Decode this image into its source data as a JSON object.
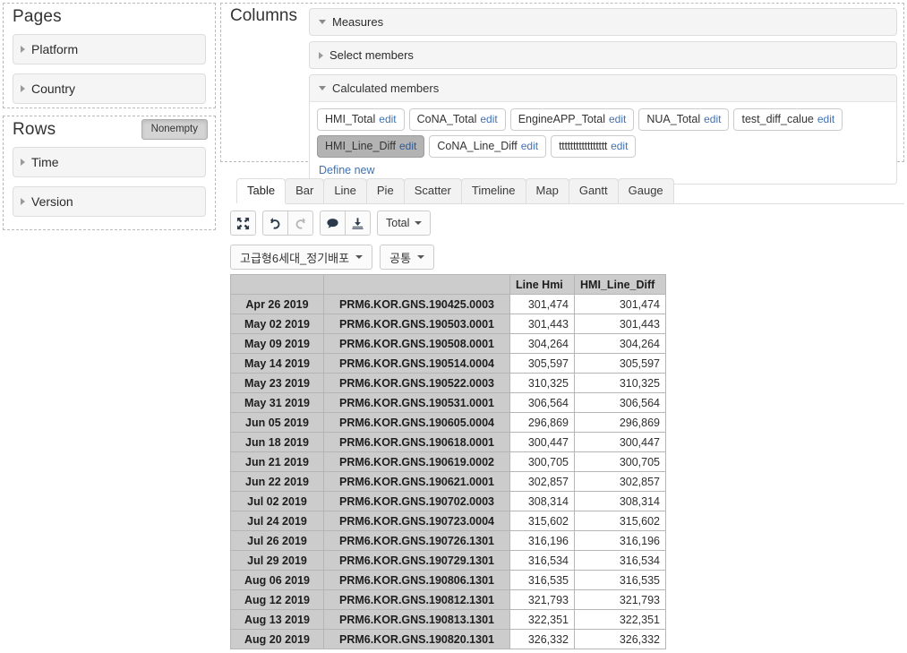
{
  "pages": {
    "title": "Pages",
    "hierarchies": [
      {
        "label": "Platform",
        "expanded": false
      },
      {
        "label": "Country",
        "expanded": false
      }
    ]
  },
  "rows": {
    "title": "Rows",
    "nonempty_label": "Nonempty",
    "hierarchies": [
      {
        "label": "Time",
        "expanded": false
      },
      {
        "label": "Version",
        "expanded": false
      }
    ]
  },
  "columns": {
    "title": "Columns",
    "measures_label": "Measures",
    "select_members_label": "Select members",
    "calculated_members_label": "Calculated members",
    "define_new_label": "Define new",
    "edit_label": "edit",
    "calculated_members": [
      {
        "name": "HMI_Total",
        "selected": false
      },
      {
        "name": "CoNA_Total",
        "selected": false
      },
      {
        "name": "EngineAPP_Total",
        "selected": false
      },
      {
        "name": "NUA_Total",
        "selected": false
      },
      {
        "name": "test_diff_calue",
        "selected": false
      },
      {
        "name": "HMI_Line_Diff",
        "selected": true
      },
      {
        "name": "CoNA_Line_Diff",
        "selected": false
      },
      {
        "name": "ttttttttttttttttt",
        "selected": false
      }
    ]
  },
  "tabs": [
    {
      "label": "Table",
      "active": true
    },
    {
      "label": "Bar",
      "active": false
    },
    {
      "label": "Line",
      "active": false
    },
    {
      "label": "Pie",
      "active": false
    },
    {
      "label": "Scatter",
      "active": false
    },
    {
      "label": "Timeline",
      "active": false
    },
    {
      "label": "Map",
      "active": false
    },
    {
      "label": "Gantt",
      "active": false
    },
    {
      "label": "Gauge",
      "active": false
    }
  ],
  "toolbar": {
    "fullscreen_icon": "expand-arrows-icon",
    "undo_icon": "undo-icon",
    "redo_icon": "redo-icon",
    "comment_icon": "comment-icon",
    "export_icon": "download-icon",
    "total_label": "Total"
  },
  "filters": [
    {
      "label": "고급형6세대_정기배포"
    },
    {
      "label": "공통"
    }
  ],
  "table": {
    "headers": [
      "",
      "",
      "Line Hmi",
      "HMI_Line_Diff"
    ],
    "rows": [
      [
        "Apr 26 2019",
        "PRM6.KOR.GNS.190425.0003",
        "301,474",
        "301,474"
      ],
      [
        "May 02 2019",
        "PRM6.KOR.GNS.190503.0001",
        "301,443",
        "301,443"
      ],
      [
        "May 09 2019",
        "PRM6.KOR.GNS.190508.0001",
        "304,264",
        "304,264"
      ],
      [
        "May 14 2019",
        "PRM6.KOR.GNS.190514.0004",
        "305,597",
        "305,597"
      ],
      [
        "May 23 2019",
        "PRM6.KOR.GNS.190522.0003",
        "310,325",
        "310,325"
      ],
      [
        "May 31 2019",
        "PRM6.KOR.GNS.190531.0001",
        "306,564",
        "306,564"
      ],
      [
        "Jun 05 2019",
        "PRM6.KOR.GNS.190605.0004",
        "296,869",
        "296,869"
      ],
      [
        "Jun 18 2019",
        "PRM6.KOR.GNS.190618.0001",
        "300,447",
        "300,447"
      ],
      [
        "Jun 21 2019",
        "PRM6.KOR.GNS.190619.0002",
        "300,705",
        "300,705"
      ],
      [
        "Jun 22 2019",
        "PRM6.KOR.GNS.190621.0001",
        "302,857",
        "302,857"
      ],
      [
        "Jul 02 2019",
        "PRM6.KOR.GNS.190702.0003",
        "308,314",
        "308,314"
      ],
      [
        "Jul 24 2019",
        "PRM6.KOR.GNS.190723.0004",
        "315,602",
        "315,602"
      ],
      [
        "Jul 26 2019",
        "PRM6.KOR.GNS.190726.1301",
        "316,196",
        "316,196"
      ],
      [
        "Jul 29 2019",
        "PRM6.KOR.GNS.190729.1301",
        "316,534",
        "316,534"
      ],
      [
        "Aug 06 2019",
        "PRM6.KOR.GNS.190806.1301",
        "316,535",
        "316,535"
      ],
      [
        "Aug 12 2019",
        "PRM6.KOR.GNS.190812.1301",
        "321,793",
        "321,793"
      ],
      [
        "Aug 13 2019",
        "PRM6.KOR.GNS.190813.1301",
        "322,351",
        "322,351"
      ],
      [
        "Aug 20 2019",
        "PRM6.KOR.GNS.190820.1301",
        "326,332",
        "326,332"
      ]
    ]
  },
  "colors": {
    "link": "#3f72b5",
    "header_bg": "#cccccc",
    "selected_chip_bg": "#b3b3b3"
  }
}
